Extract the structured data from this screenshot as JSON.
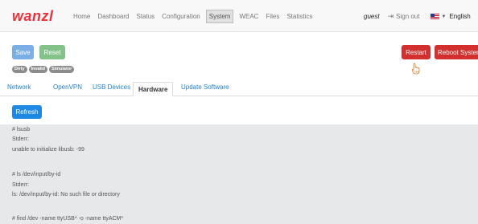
{
  "navbar": {
    "brand": "wanzl",
    "items": [
      {
        "label": "Home"
      },
      {
        "label": "Dashboard"
      },
      {
        "label": "Status"
      },
      {
        "label": "Configuration"
      },
      {
        "label": "System"
      },
      {
        "label": "WEAC"
      },
      {
        "label": "Files"
      },
      {
        "label": "Statistics"
      }
    ],
    "active": "System",
    "user": "guest",
    "signout_label": "Sign out",
    "language": "English"
  },
  "toolbar": {
    "save_label": "Save",
    "reset_label": "Reset",
    "restart_label": "Restart",
    "reboot_label": "Reboot System"
  },
  "badges": [
    "Dirty",
    "Invalid",
    "Simulator"
  ],
  "tabs": [
    {
      "label": "Network"
    },
    {
      "label": "OpenVPN"
    },
    {
      "label": "USB Devices"
    },
    {
      "label": "Hardware"
    },
    {
      "label": "Update Software"
    }
  ],
  "active_tab": "Hardware",
  "refresh_label": "Refresh",
  "output": [
    "# lsusb",
    "Stderr:",
    "unable to initialize libusb: -99",
    "# ls /dev/input/by-id",
    "Stderr:",
    "ls: /dev/input/by-id: No such file or directory",
    "# find /dev -name ttyUSB* -o -name ttyACM*"
  ],
  "colors": {
    "brand": "#e8323c",
    "save": "#7aaee6",
    "reset": "#83c38a",
    "danger": "#d32f2f",
    "primary": "#1e88e5",
    "link": "#1e7fd8",
    "panel": "#e6e8ea"
  }
}
